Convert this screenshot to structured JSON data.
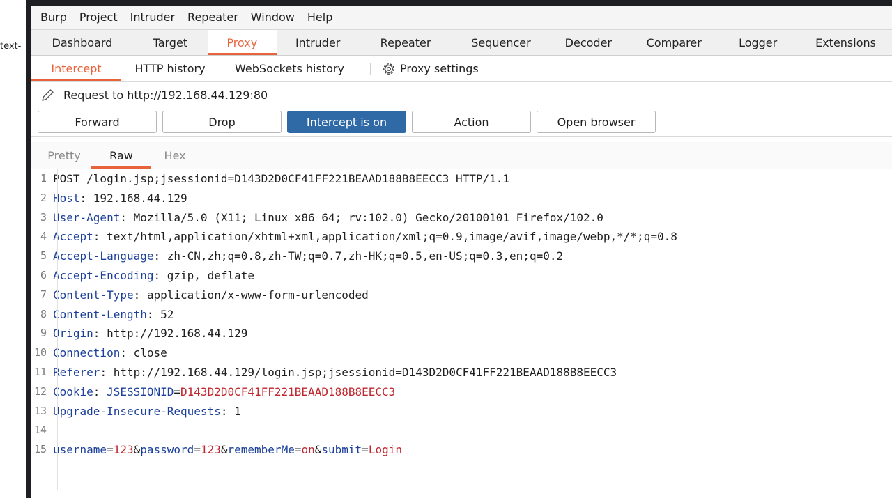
{
  "left_strip": {
    "text": "text-"
  },
  "menu": [
    "Burp",
    "Project",
    "Intruder",
    "Repeater",
    "Window",
    "Help"
  ],
  "main_tabs": [
    "Dashboard",
    "Target",
    "Proxy",
    "Intruder",
    "Repeater",
    "Sequencer",
    "Decoder",
    "Comparer",
    "Logger",
    "Extensions"
  ],
  "active_main_tab": "Proxy",
  "sub_tabs": {
    "intercept": "Intercept",
    "history": "HTTP history",
    "websockets": "WebSockets history",
    "settings": "Proxy settings"
  },
  "request_line": "Request to http://192.168.44.129:80",
  "buttons": {
    "forward": "Forward",
    "drop": "Drop",
    "intercept": "Intercept is on",
    "action": "Action",
    "open_browser": "Open browser"
  },
  "editor_tabs": {
    "pretty": "Pretty",
    "raw": "Raw",
    "hex": "Hex"
  },
  "colors": {
    "accent": "#e8633a",
    "primary_button": "#2f6aa7",
    "header_key": "#1b3f9a",
    "cookie_value": "#c0262d"
  },
  "request": {
    "l1": {
      "n": "1",
      "text": "POST /login.jsp;jsessionid=D143D2D0CF41FF221BEAAD188B8EECC3 HTTP/1.1"
    },
    "l2": {
      "n": "2",
      "key": "Host",
      "val": "192.168.44.129"
    },
    "l3": {
      "n": "3",
      "key": "User-Agent",
      "val": "Mozilla/5.0 (X11; Linux x86_64; rv:102.0) Gecko/20100101 Firefox/102.0"
    },
    "l4": {
      "n": "4",
      "key": "Accept",
      "val": "text/html,application/xhtml+xml,application/xml;q=0.9,image/avif,image/webp,*/*;q=0.8"
    },
    "l5": {
      "n": "5",
      "key": "Accept-Language",
      "val": "zh-CN,zh;q=0.8,zh-TW;q=0.7,zh-HK;q=0.5,en-US;q=0.3,en;q=0.2"
    },
    "l6": {
      "n": "6",
      "key": "Accept-Encoding",
      "val": "gzip, deflate"
    },
    "l7": {
      "n": "7",
      "key": "Content-Type",
      "val": "application/x-www-form-urlencoded"
    },
    "l8": {
      "n": "8",
      "key": "Content-Length",
      "val": "52"
    },
    "l9": {
      "n": "9",
      "key": "Origin",
      "val": "http://192.168.44.129"
    },
    "l10": {
      "n": "10",
      "key": "Connection",
      "val": "close"
    },
    "l11": {
      "n": "11",
      "key": "Referer",
      "val": "http://192.168.44.129/login.jsp;jsessionid=D143D2D0CF41FF221BEAAD188B8EECC3"
    },
    "l12": {
      "n": "12",
      "key": "Cookie",
      "ckey": "JSESSIONID",
      "cval": "D143D2D0CF41FF221BEAAD188B8EECC3"
    },
    "l13": {
      "n": "13",
      "key": "Upgrade-Insecure-Requests",
      "val": "1"
    },
    "l14": {
      "n": "14"
    },
    "l15": {
      "n": "15",
      "p1k": "username",
      "p1v": "123",
      "p2k": "password",
      "p2v": "123",
      "p3k": "rememberMe",
      "p3v": "on",
      "p4k": "submit",
      "p4v": "Login"
    }
  }
}
